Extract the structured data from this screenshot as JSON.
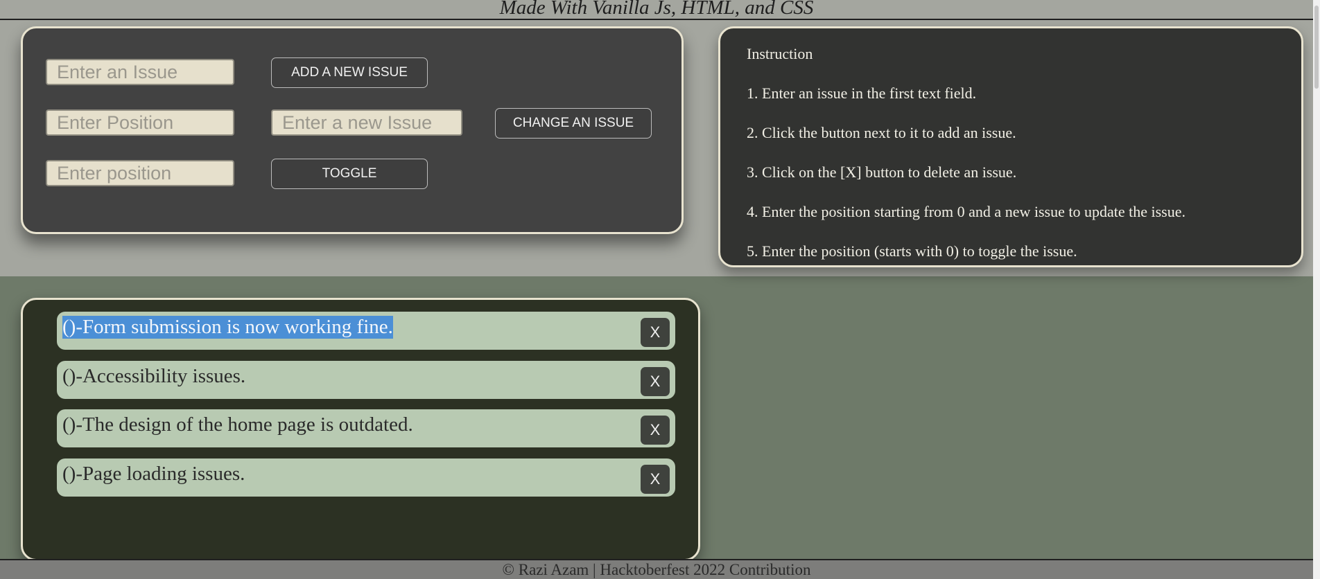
{
  "header": {
    "text": "Made With Vanilla Js, HTML, and CSS"
  },
  "controls": {
    "issue_input_placeholder": "Enter an Issue",
    "add_button": "ADD A NEW ISSUE",
    "position_input_placeholder": "Enter Position",
    "new_issue_input_placeholder": "Enter a new Issue",
    "change_button": "CHANGE AN ISSUE",
    "toggle_position_placeholder": "Enter position",
    "toggle_button": "TOGGLE"
  },
  "instructions": {
    "title": "Instruction",
    "steps": [
      "1. Enter an issue in the first text field.",
      "2. Click the button next to it to add an issue.",
      "3. Click on the [X] button to delete an issue.",
      "4. Enter the position starting from 0 and a new issue to update the issue.",
      "5. Enter the position (starts with 0) to toggle the issue."
    ]
  },
  "issues": [
    {
      "text": "()-Form submission is now working fine.",
      "selected": true,
      "delete_label": "X"
    },
    {
      "text": "()-Accessibility issues.",
      "delete_label": "X"
    },
    {
      "text": "()-The design of the home page is outdated.",
      "delete_label": "X"
    },
    {
      "text": "()-Page loading issues.",
      "delete_label": "X"
    }
  ],
  "footer": {
    "text": "© Razi Azam | Hacktoberfest 2022 Contribution"
  },
  "colors": {
    "top_band": "#a4a69f",
    "page_background": "#6e7a69",
    "controls_card": "#424242",
    "instructions_card": "#323331",
    "list_card": "#2c3123",
    "issue_item": "#b8cab2",
    "card_border": "#e8e3cf",
    "selection_highlight": "#4b8fd6"
  }
}
